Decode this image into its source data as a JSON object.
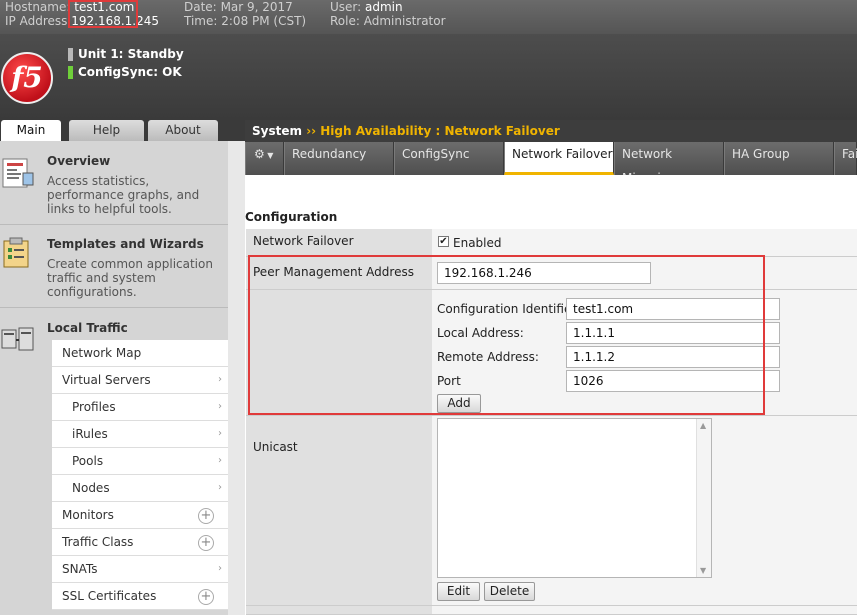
{
  "header": {
    "hostname_label": "Hostname:",
    "hostname": "test1.com",
    "ip_label": "IP Address",
    "ip": "192.168.1.245",
    "date_label": "Date:",
    "date": "Mar 9, 2017",
    "time_label": "Time:",
    "time": "2:08 PM (CST)",
    "user_label": "User:",
    "user": "admin",
    "role_label": "Role:",
    "role": "Administrator"
  },
  "banner": {
    "logo_text": "f5",
    "unit_status": "Unit 1: Standby",
    "configsync": "ConfigSync: OK"
  },
  "left_tabs": [
    "Main",
    "Help",
    "About"
  ],
  "sidebar": {
    "overview": {
      "title": "Overview",
      "desc": "Access statistics, performance graphs, and links to helpful tools."
    },
    "templates": {
      "title": "Templates and Wizards",
      "desc": "Create common application traffic and system configurations."
    },
    "local_traffic": {
      "title": "Local Traffic"
    },
    "items": [
      "Network Map",
      "Virtual Servers",
      "Profiles",
      "iRules",
      "Pools",
      "Nodes",
      "Monitors",
      "Traffic Class",
      "SNATs",
      "SSL Certificates"
    ]
  },
  "breadcrumb": {
    "root": "System",
    "sep": "››",
    "current": "High Availability : Network Failover"
  },
  "nav_tabs": [
    "Redundancy",
    "ConfigSync",
    "Network Failover",
    "Network Mirroring",
    "HA Group",
    "Fai"
  ],
  "form": {
    "section_title": "Configuration",
    "network_failover_label": "Network Failover",
    "enabled_label": "Enabled",
    "peer_mgmt_label": "Peer Management Address",
    "peer_mgmt_value": "192.168.1.246",
    "config_id_label": "Configuration Identifier:",
    "config_id_value": "test1.com",
    "local_addr_label": "Local Address:",
    "local_addr_value": "1.1.1.1",
    "remote_addr_label": "Remote Address:",
    "remote_addr_value": "1.1.1.2",
    "port_label": "Port",
    "port_value": "1026",
    "add_button": "Add",
    "unicast_label": "Unicast",
    "edit_button": "Edit",
    "delete_button": "Delete"
  },
  "colors": {
    "accent": "#f0b400",
    "highlight_box": "#e03a3a",
    "status_ok": "#6fcf3a"
  }
}
